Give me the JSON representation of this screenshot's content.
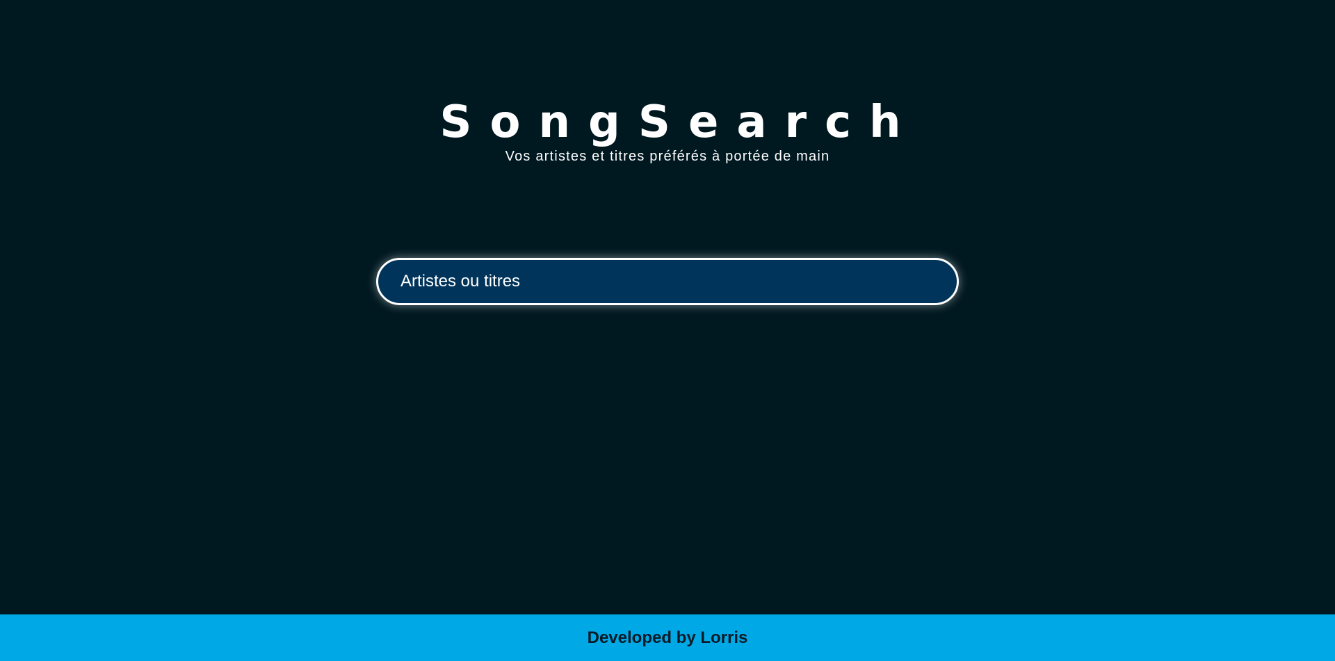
{
  "app": {
    "title": "SongSearch",
    "tagline": "Vos artistes et titres préférés à portée de main"
  },
  "search": {
    "placeholder": "Artistes ou titres",
    "value": ""
  },
  "footer": {
    "text": "Developed by Lorris"
  },
  "colors": {
    "background": "#001820",
    "search_fill": "#00345a",
    "search_border": "#ffffff",
    "footer_bg": "#00a9e6",
    "footer_text": "#0a1a26",
    "text": "#ffffff"
  }
}
